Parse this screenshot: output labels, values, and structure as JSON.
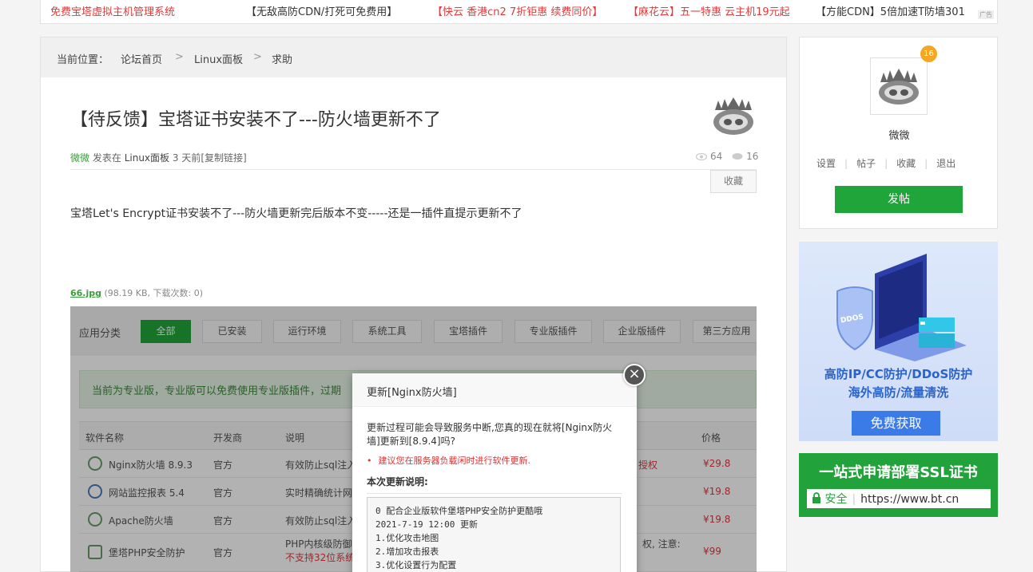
{
  "top_ads": [
    {
      "text": "免费宝塔虚拟主机管理系统",
      "color": "#e03b3b"
    },
    {
      "text": "【无敌高防CDN/打死可免费用】",
      "color": "#333333"
    },
    {
      "text": "【快云 香港cn2 7折钜惠 续费同价】",
      "color": "#e03b3b"
    },
    {
      "text": "【麻花云】五一特惠 云主机19元起",
      "color": "#e03b3b"
    },
    {
      "text": "【方能CDN】5倍加速T防墙301",
      "color": "#333333"
    }
  ],
  "top_ad_tag": "广告",
  "breadcrumb": {
    "label": "当前位置：",
    "items": [
      "论坛首页",
      "Linux面板",
      "求助"
    ],
    "separator": ">"
  },
  "post": {
    "title": "【待反馈】宝塔证书安装不了---防火墙更新不了",
    "author": "微微",
    "posted_in_label": "发表在",
    "forum": "Linux面板",
    "time": "3 天前",
    "copy_link": "[复制链接]",
    "views": "64",
    "replies": "16",
    "favorite_label": "收藏",
    "body": "宝塔Let's Encrypt证书安装不了---防火墙更新完后版本不变-----还是一插件直提示更新不了",
    "attachment": {
      "name": "66.jpg",
      "info": "(98.19 KB, 下载次数: 0)"
    }
  },
  "screenshot": {
    "category_label": "应用分类",
    "tabs": [
      "全部",
      "已安装",
      "运行环境",
      "系统工具",
      "宝塔插件",
      "专业版插件",
      "企业版插件",
      "第三方应用"
    ],
    "notice": "当前为专业版，专业版可以免费使用专业版插件，过期",
    "columns": [
      "软件名称",
      "开发商",
      "说明",
      "价格"
    ],
    "rows": [
      {
        "name": "Nginx防火墙 8.9.3",
        "dev": "官方",
        "desc": "有效防止sql注入",
        "extra": "授权",
        "price": "¥29.8"
      },
      {
        "name": "网站监控报表 5.4",
        "dev": "官方",
        "desc": "实时精确统计网",
        "extra": "",
        "price": "¥19.8"
      },
      {
        "name": "Apache防火墙",
        "dev": "官方",
        "desc": "有效防止sql注入",
        "extra": "",
        "price": "¥19.8"
      },
      {
        "name": "堡塔PHP安全防护",
        "dev": "官方",
        "desc": "PHP内核级防御",
        "desc2": "不支持32位系统",
        "extra": "权, 注意:",
        "price": "¥99"
      }
    ],
    "dialog": {
      "title": "更新[Nginx防火墙]",
      "message": "更新过程可能会导致服务中断,您真的现在就将[Nginx防火墙]更新到[8.9.4]吗?",
      "warning": "建议您在服务器负载闲时进行软件更新.",
      "notes_title": "本次更新说明:",
      "notes": [
        "0 配合企业版软件堡塔PHP安全防护更酷哦",
        "2021-7-19 12:00 更新",
        "1.优化攻击地图",
        "2.增加攻击报表",
        "3.优化设置行为配置"
      ],
      "close_symbol": "×"
    }
  },
  "sidebar": {
    "badge": "16",
    "username": "微微",
    "links": [
      "设置",
      "帖子",
      "收藏",
      "退出"
    ],
    "post_button": "发帖"
  },
  "ad_ddos": {
    "badge": "DDOS",
    "line1": "高防IP/CC防护/DDoS防护",
    "line2": "海外高防/流量清洗",
    "cta": "免费获取"
  },
  "ad_ssl": {
    "headline": "一站式申请部署SSL证书",
    "secure": "安全",
    "url": "https://www.bt.cn"
  },
  "colors": {
    "brand_green": "#20a53a",
    "price_red": "#e4393c",
    "link_green": "#3a9d3a"
  }
}
